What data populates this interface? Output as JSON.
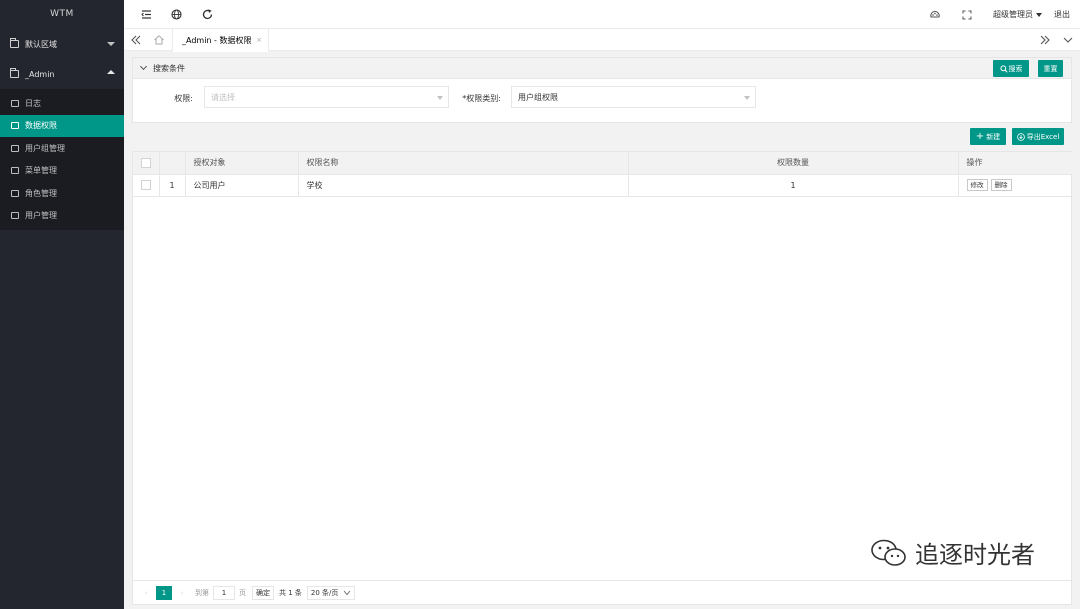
{
  "app": {
    "logo": "WTM"
  },
  "sidebar": {
    "groups": [
      {
        "label": "默认区域",
        "expanded": false
      },
      {
        "label": "_Admin",
        "expanded": true
      }
    ],
    "items": [
      {
        "label": "日志",
        "active": false
      },
      {
        "label": "数据权限",
        "active": true
      },
      {
        "label": "用户组管理",
        "active": false
      },
      {
        "label": "菜单管理",
        "active": false
      },
      {
        "label": "角色管理",
        "active": false
      },
      {
        "label": "用户管理",
        "active": false
      }
    ]
  },
  "topbar": {
    "icons": [
      "menu-toggle-icon",
      "globe-icon",
      "refresh-icon",
      "theme-icon",
      "fullscreen-icon"
    ],
    "user": "超级管理员",
    "logout": "退出"
  },
  "tabs": {
    "active_label": "_Admin - 数据权限",
    "close": "×"
  },
  "search": {
    "title": "搜索条件",
    "search_button": "搜索",
    "reset_button": "重置",
    "field1_label": "权限:",
    "field1_placeholder": "请选择",
    "field2_label": "*权限类别:",
    "field2_value": "用户组权限"
  },
  "toolbar": {
    "add_button": "新建",
    "export_button": "导出Excel"
  },
  "table": {
    "headers": [
      "授权对象",
      "权限名称",
      "权限数量",
      "操作"
    ],
    "rows": [
      {
        "index": "1",
        "object": "公司用户",
        "name": "学校",
        "count": "1",
        "edit": "修改",
        "delete": "删除"
      }
    ]
  },
  "pager": {
    "prev": "‹",
    "current_page": "1",
    "next": "›",
    "goto_label": "到第",
    "goto_value": "1",
    "page_unit": "页",
    "confirm": "确定",
    "total": "共 1 条",
    "page_size": "20 条/页"
  },
  "watermark": {
    "text": "追逐时光者"
  },
  "colors": {
    "accent": "#009688",
    "sidebar_bg": "#23262e"
  }
}
